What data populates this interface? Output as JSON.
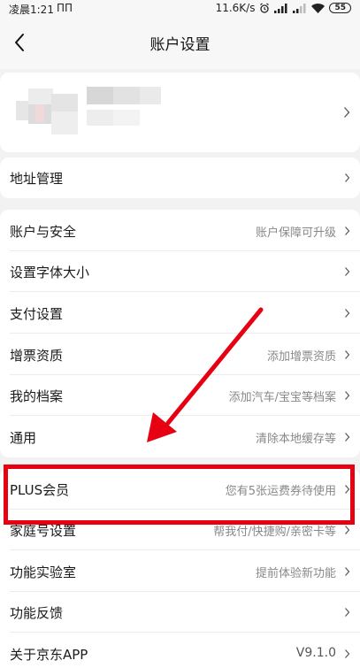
{
  "status_bar": {
    "time": "凌晨1:21",
    "app_indicator": "ΠΠ",
    "speed": "11.6K/s",
    "battery": "55",
    "icons": [
      "alarm-icon",
      "signal-icon",
      "signal-icon",
      "wifi-icon",
      "battery-icon"
    ]
  },
  "header": {
    "title": "账户设置",
    "back_icon": "chevron-left-icon"
  },
  "colors": {
    "accent_red": "#e60012",
    "background": "#f2f2f2",
    "card": "#ffffff",
    "secondary_text": "#888888"
  },
  "address": {
    "label": "地址管理"
  },
  "menu": [
    {
      "label": "账户与安全",
      "value": "账户保障可升级"
    },
    {
      "label": "设置字体大小",
      "value": ""
    },
    {
      "label": "支付设置",
      "value": ""
    },
    {
      "label": "增票资质",
      "value": "添加增票资质"
    },
    {
      "label": "我的档案",
      "value": "添加汽车/宝宝等档案"
    },
    {
      "label": "通用",
      "value": "清除本地缓存等"
    }
  ],
  "menu2": [
    {
      "label": "PLUS会员",
      "value": "您有5张运费券待使用"
    },
    {
      "label": "家庭号设置",
      "value": "帮我付/快捷购/亲密卡等"
    },
    {
      "label": "功能实验室",
      "value": "提前体验新功能"
    },
    {
      "label": "功能反馈",
      "value": ""
    },
    {
      "label": "关于京东APP",
      "value": "V9.1.0"
    }
  ]
}
